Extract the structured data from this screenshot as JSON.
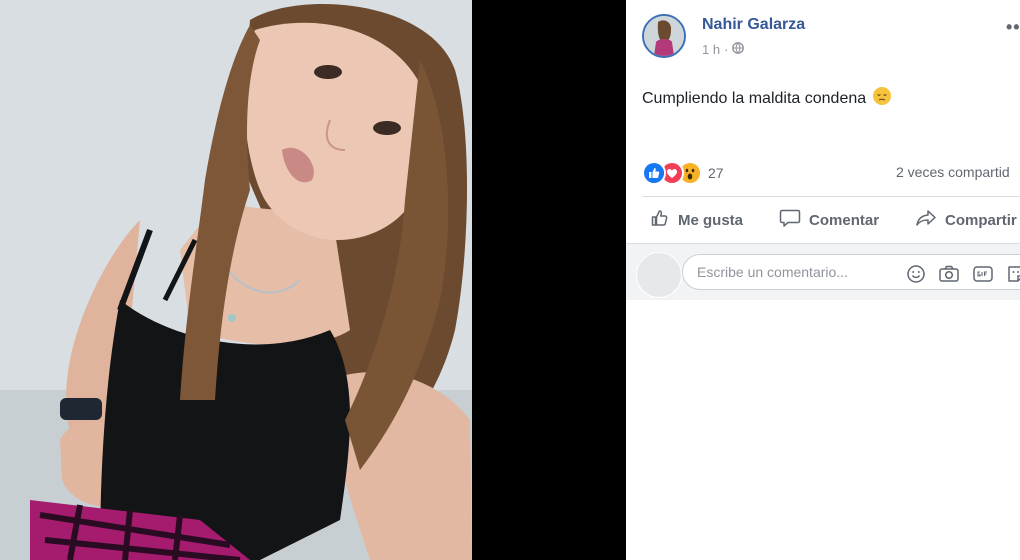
{
  "post": {
    "author": "Nahir Galarza",
    "time": "1 h",
    "privacy_icon": "globe-icon",
    "more_label": "•••",
    "text": "Cumpliendo la maldita condena",
    "emoji": "pensive-face-emoji"
  },
  "reactions": {
    "icons": [
      "like-reaction-icon",
      "love-reaction-icon",
      "wow-reaction-icon"
    ],
    "count": "27",
    "shares": "2 veces compartid"
  },
  "actions": {
    "like": "Me gusta",
    "comment": "Comentar",
    "share": "Compartir"
  },
  "comment_box": {
    "placeholder": "Escribe un comentario...",
    "icons": [
      "emoji-icon",
      "camera-icon",
      "gif-icon",
      "sticker-icon"
    ]
  },
  "colors": {
    "author_blue": "#365899",
    "like_blue": "#1877f2",
    "love_red": "#f33e58",
    "wow_yellow": "#f7b125",
    "text_grey": "#606770",
    "panel_bg": "#ffffff",
    "page_bg": "#000000"
  }
}
